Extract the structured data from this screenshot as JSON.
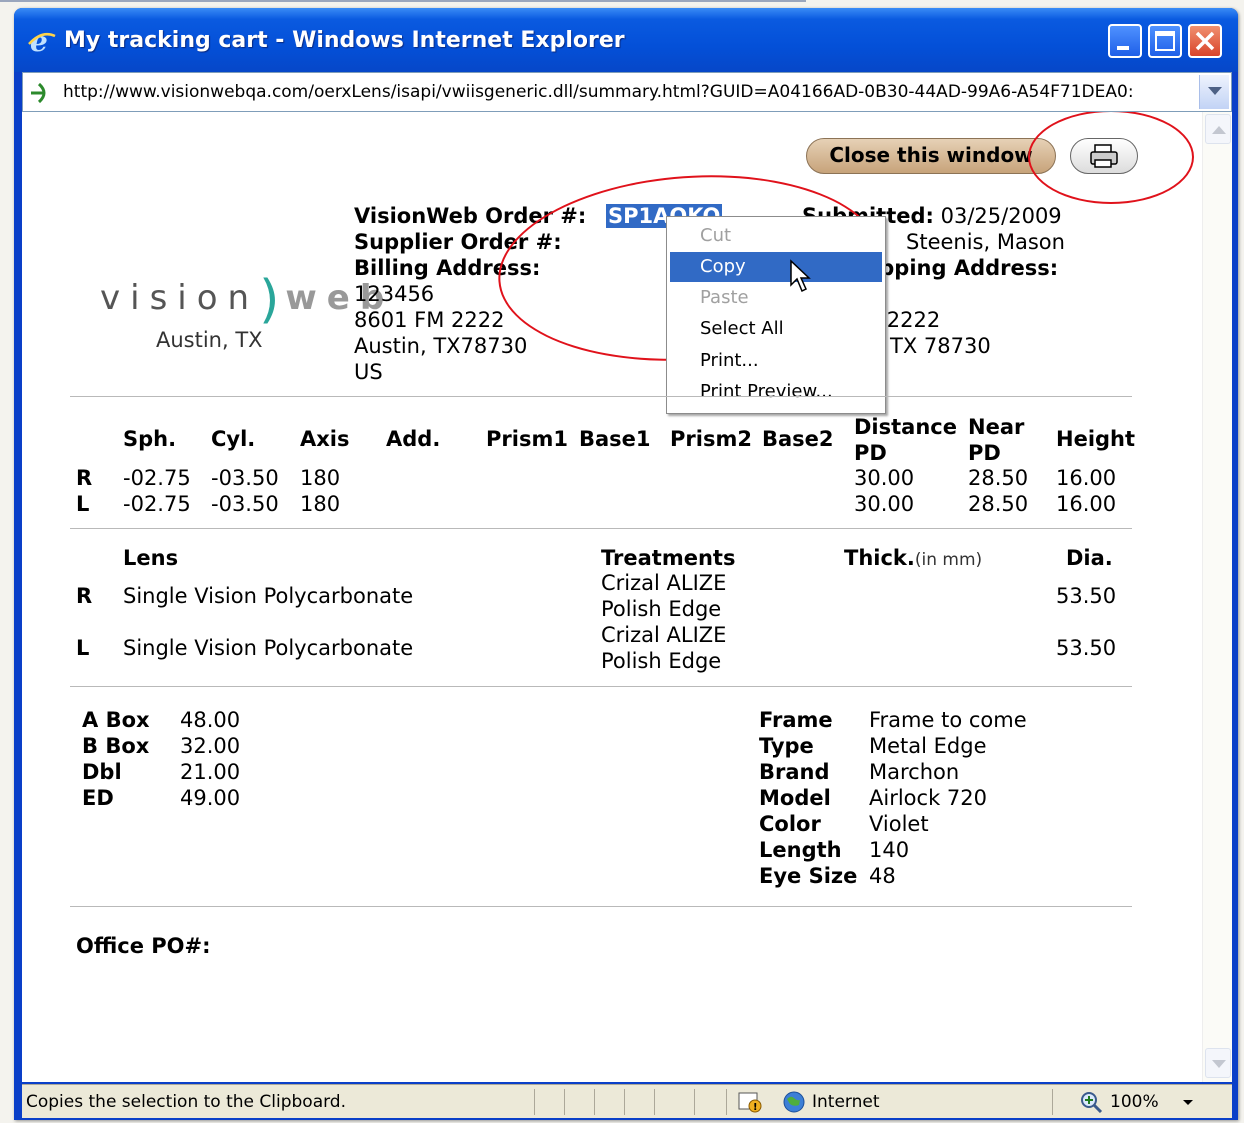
{
  "window": {
    "title": "My tracking cart - Windows Internet Explorer",
    "url": "http://www.visionwebqa.com/oerxLens/isapi/vwiisgeneric.dll/summary.html?GUID=A04166AD-0B30-44AD-99A6-A54F71DEA0:"
  },
  "toolbar": {
    "close_window_label": "Close this window"
  },
  "logo": {
    "word1": "vision",
    "word2": "web",
    "location": "Austin, TX"
  },
  "order": {
    "order_label": "VisionWeb Order #:",
    "order_number": "SP1AOKO",
    "supplier_order_label": "Supplier Order #:",
    "billing_label": "Billing Address:",
    "billing_lines": [
      "123456",
      "8601 FM 2222",
      "Austin, TX78730",
      "US"
    ],
    "submitted_label": "Submitted:",
    "submitted_value": "03/25/2009",
    "patient_partial": "Steenis, Mason",
    "shipping_label": "Shipping Address:",
    "shipping_line2_partial": "M 2222",
    "shipping_line3_partial": "TX 78730",
    "shipping_line1_partial": "6"
  },
  "context_menu": {
    "items": [
      "Cut",
      "Copy",
      "Paste",
      "Select All",
      "Print...",
      "Print Preview..."
    ],
    "selected": "Copy"
  },
  "rx": {
    "headers": [
      "Sph.",
      "Cyl.",
      "Axis",
      "Add.",
      "Prism1",
      "Base1",
      "Prism2",
      "Base2"
    ],
    "distance_pd_label": "Distance PD",
    "near_pd_label": "Near PD",
    "height_label": "Height",
    "rows": [
      {
        "eye": "R",
        "sph": "-02.75",
        "cyl": "-03.50",
        "axis": "180",
        "dist_pd": "30.00",
        "near_pd": "28.50",
        "height": "16.00"
      },
      {
        "eye": "L",
        "sph": "-02.75",
        "cyl": "-03.50",
        "axis": "180",
        "dist_pd": "30.00",
        "near_pd": "28.50",
        "height": "16.00"
      }
    ]
  },
  "lens": {
    "lens_label": "Lens",
    "treatments_label": "Treatments",
    "thick_label": "Thick.",
    "thick_unit": "(in mm)",
    "dia_label": "Dia.",
    "rows": [
      {
        "eye": "R",
        "lens": "Single Vision Polycarbonate",
        "t1": "Crizal ALIZE",
        "t2": "Polish Edge",
        "dia": "53.50"
      },
      {
        "eye": "L",
        "lens": "Single Vision Polycarbonate",
        "t1": "Crizal ALIZE",
        "t2": "Polish Edge",
        "dia": "53.50"
      }
    ]
  },
  "measurements": [
    {
      "label": "A Box",
      "value": "48.00"
    },
    {
      "label": "B Box",
      "value": "32.00"
    },
    {
      "label": "Dbl",
      "value": "21.00"
    },
    {
      "label": "ED",
      "value": "49.00"
    }
  ],
  "frame": [
    {
      "label": "Frame",
      "value": "Frame to come"
    },
    {
      "label": "Type",
      "value": "Metal Edge"
    },
    {
      "label": "Brand",
      "value": "Marchon"
    },
    {
      "label": "Model",
      "value": "Airlock 720"
    },
    {
      "label": "Color",
      "value": "Violet"
    },
    {
      "label": "Length",
      "value": "140"
    },
    {
      "label": "Eye Size",
      "value": "48"
    }
  ],
  "office_po_label": "Office PO#:",
  "status": {
    "message": "Copies the selection to the Clipboard.",
    "zone": "Internet",
    "zoom": "100%"
  },
  "colors": {
    "highlight": "#316ac5",
    "annotation_red": "#e0121b",
    "titlebar": "#0a5ae0"
  }
}
